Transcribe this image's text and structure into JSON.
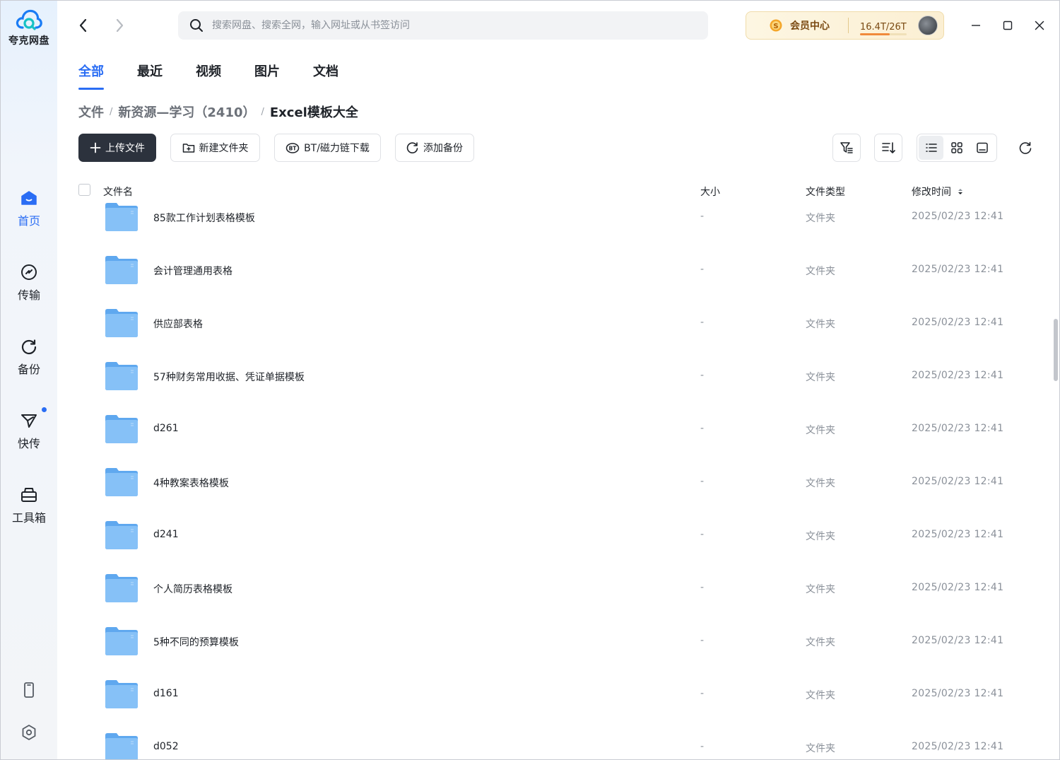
{
  "app": {
    "name": "夸克网盘"
  },
  "sidebar": {
    "items": [
      {
        "label": "首页",
        "icon": "home-icon",
        "active": true
      },
      {
        "label": "传输",
        "icon": "transfer-icon"
      },
      {
        "label": "备份",
        "icon": "backup-icon"
      },
      {
        "label": "快传",
        "icon": "send-icon"
      },
      {
        "label": "工具箱",
        "icon": "toolbox-icon"
      }
    ],
    "bottom_icons": [
      "phone-icon",
      "settings-icon"
    ]
  },
  "search": {
    "placeholder": "搜索网盘、搜索全网，输入网址或从书签访问"
  },
  "vip": {
    "label": "会员中心",
    "storage": "16.4T/26T",
    "storage_used_fraction": 0.63
  },
  "tabs": [
    "全部",
    "最近",
    "视频",
    "图片",
    "文档"
  ],
  "breadcrumb": [
    "文件",
    "新资源—学习（2410）",
    "Excel模板大全"
  ],
  "toolbar": {
    "upload": "上传文件",
    "new_folder": "新建文件夹",
    "bt_download": "BT/磁力链下载",
    "add_backup": "添加备份"
  },
  "table": {
    "headers": {
      "name": "文件名",
      "size": "大小",
      "type": "文件类型",
      "modified": "修改时间"
    },
    "rows": [
      {
        "name": "85款工作计划表格模板",
        "size": "-",
        "type": "文件夹",
        "modified": "2025/02/23 12:41"
      },
      {
        "name": "会计管理通用表格",
        "size": "-",
        "type": "文件夹",
        "modified": "2025/02/23 12:41"
      },
      {
        "name": "供应部表格",
        "size": "-",
        "type": "文件夹",
        "modified": "2025/02/23 12:41"
      },
      {
        "name": "57种财务常用收据、凭证单据模板",
        "size": "-",
        "type": "文件夹",
        "modified": "2025/02/23 12:41"
      },
      {
        "name": "d261",
        "size": "-",
        "type": "文件夹",
        "modified": "2025/02/23 12:41"
      },
      {
        "name": "4种教案表格模板",
        "size": "-",
        "type": "文件夹",
        "modified": "2025/02/23 12:41"
      },
      {
        "name": "d241",
        "size": "-",
        "type": "文件夹",
        "modified": "2025/02/23 12:41"
      },
      {
        "name": "个人简历表格模板",
        "size": "-",
        "type": "文件夹",
        "modified": "2025/02/23 12:41"
      },
      {
        "name": "5种不同的预算模板",
        "size": "-",
        "type": "文件夹",
        "modified": "2025/02/23 12:41"
      },
      {
        "name": "d161",
        "size": "-",
        "type": "文件夹",
        "modified": "2025/02/23 12:41"
      },
      {
        "name": "d052",
        "size": "-",
        "type": "文件夹",
        "modified": "2025/02/23 12:41"
      }
    ]
  },
  "colors": {
    "accent": "#2a6df4",
    "primary_button": "#2c323d",
    "folder": "#5fa8ef"
  }
}
